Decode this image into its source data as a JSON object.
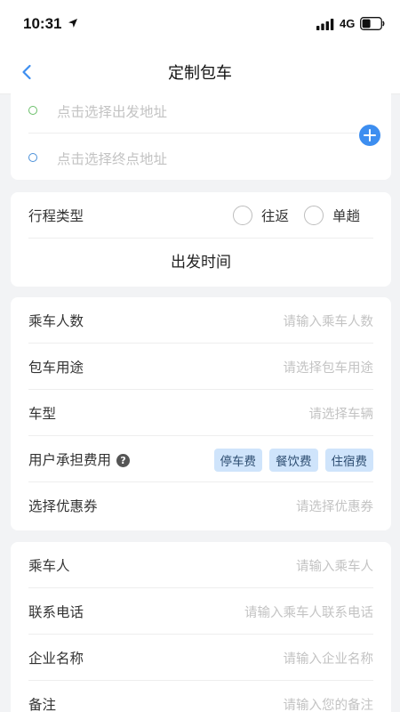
{
  "status_bar": {
    "time": "10:31",
    "network": "4G"
  },
  "nav": {
    "title": "定制包车"
  },
  "address": {
    "start_placeholder": "点击选择出发地址",
    "end_placeholder": "点击选择终点地址"
  },
  "trip": {
    "type_label": "行程类型",
    "options": [
      "往返",
      "单趟"
    ],
    "depart_time_label": "出发时间"
  },
  "details": {
    "rows": [
      {
        "label": "乘车人数",
        "placeholder": "请输入乘车人数"
      },
      {
        "label": "包车用途",
        "placeholder": "请选择包车用途"
      },
      {
        "label": "车型",
        "placeholder": "请选择车辆"
      },
      {
        "label": "用户承担费用",
        "help": "?",
        "tags": [
          "停车费",
          "餐饮费",
          "住宿费"
        ]
      },
      {
        "label": "选择优惠券",
        "placeholder": "请选择优惠券"
      }
    ]
  },
  "passenger": {
    "rows": [
      {
        "label": "乘车人",
        "placeholder": "请输入乘车人"
      },
      {
        "label": "联系电话",
        "placeholder": "请输入乘车人联系电话"
      },
      {
        "label": "企业名称",
        "placeholder": "请输入企业名称"
      },
      {
        "label": "备注",
        "placeholder": "请输入您的备注"
      }
    ]
  },
  "colors": {
    "accent": "#3d8ef0",
    "tag_bg": "#cfe4fb",
    "page_bg": "#f2f3f5"
  },
  "icons": {
    "back": "chevron-left-icon",
    "add_stop": "plus-circle-icon",
    "location": "location-arrow-icon",
    "signal": "signal-bars-icon",
    "battery": "battery-icon",
    "help": "question-circle-icon"
  }
}
